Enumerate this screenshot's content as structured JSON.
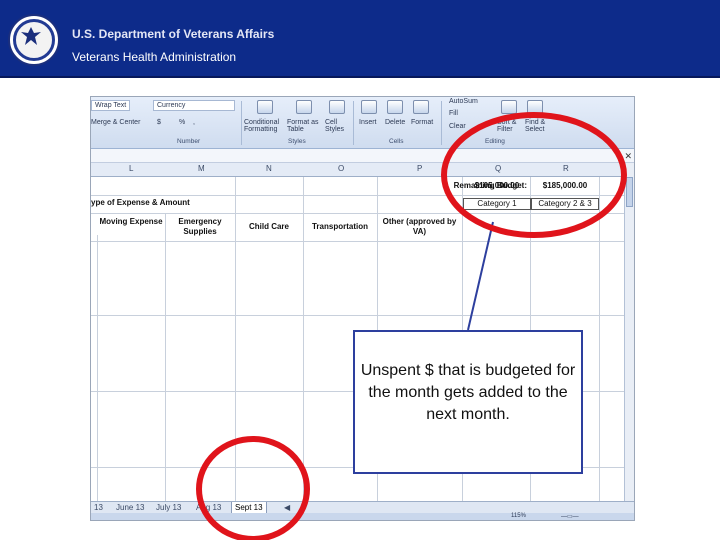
{
  "header": {
    "title": "U.S. Department of Veterans Affairs",
    "subtitle": "Veterans Health Administration"
  },
  "ribbon": {
    "wrap_text": "Wrap Text",
    "number_format": "Currency",
    "merge_center": "Merge & Center",
    "currency_symbol": "$",
    "percent": "%",
    "comma": ",",
    "conditional_formatting": "Conditional Formatting",
    "format_as_table": "Format as Table",
    "cell_styles": "Cell Styles",
    "insert": "Insert",
    "delete": "Delete",
    "format": "Format",
    "autosum": "AutoSum",
    "fill": "Fill",
    "clear": "Clear",
    "sort_filter": "Sort & Filter",
    "find_select": "Find & Select",
    "group_number": "Number",
    "group_styles": "Styles",
    "group_cells": "Cells",
    "group_editing": "Editing"
  },
  "sheet": {
    "columns": [
      "L",
      "M",
      "N",
      "O",
      "P",
      "Q",
      "R"
    ],
    "remaining_budget_label": "Remaining Budget:",
    "budget_q": "$105,000.00",
    "budget_r": "$185,000.00",
    "type_of_expense": "ype of Expense & Amount",
    "category_1": "Category 1",
    "category_2_3": "Category 2 & 3",
    "headers": {
      "moving": "Moving Expense",
      "emergency": "Emergency Supplies",
      "child_care": "Child Care",
      "transportation": "Transportation",
      "other": "Other (approved by VA)"
    }
  },
  "tabs": [
    "13",
    "June 13",
    "July 13",
    "Aug 13",
    "Sept 13"
  ],
  "active_tab": "Sept 13",
  "status": {
    "zoom": "115%"
  },
  "callout": {
    "text": "Unspent $ that is budgeted for the month gets added to the next month."
  },
  "colors": {
    "banner": "#0d2b8a",
    "annotation_red": "#e0141b",
    "callout_border": "#2d3f9e"
  }
}
